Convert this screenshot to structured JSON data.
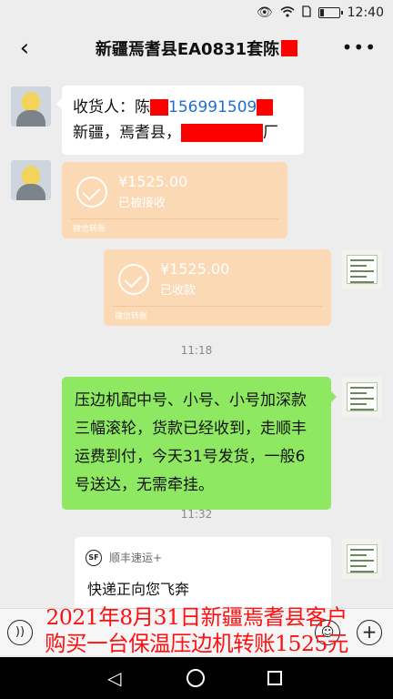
{
  "status_bar": {
    "time": "12:40",
    "eye_icon": "eye-icon",
    "wifi_icon": "wifi-icon",
    "battery_icon": "battery-icon"
  },
  "header": {
    "back_icon": "chevron-left-icon",
    "title": "新疆焉耆县EA0831套陈",
    "more_icon": "more-dots-icon"
  },
  "messages": {
    "address": {
      "line1_label": "收货人：陈",
      "line1_phone": "156991509",
      "line2_prefix": "新疆，焉耆县，",
      "line2_suffix": "厂"
    },
    "transfer_received": {
      "amount": "¥1525.00",
      "status": "已被接收",
      "footer": "微信转账"
    },
    "transfer_collected": {
      "amount": "¥1525.00",
      "status": "已收款",
      "footer": "微信转账"
    },
    "time_1": "11:18",
    "shipping_note": "压边机配中号、小号、小号加深款三幅滚轮，货款已经收到，走顺丰运费到付，今天31号发货，一般6号送达，无需牵挂。",
    "time_2": "11:32",
    "sf_card": {
      "logo_text": "SF",
      "name": "顺丰速运+",
      "message": "快递正向您飞奔"
    }
  },
  "input_bar": {
    "voice_icon": "voice-icon",
    "emoji_icon": "emoji-icon",
    "plus_icon": "plus-icon"
  },
  "caption": {
    "line1": "2021年8月31日新疆焉耆县客户",
    "line2": "购买一台保温压边机转账1525元"
  },
  "colors": {
    "chat_bg": "#ededed",
    "my_bubble": "#8fe862",
    "transfer_card": "#fbd9b4",
    "phone_link": "#1e6fd1",
    "caption_red": "#ff1010"
  }
}
